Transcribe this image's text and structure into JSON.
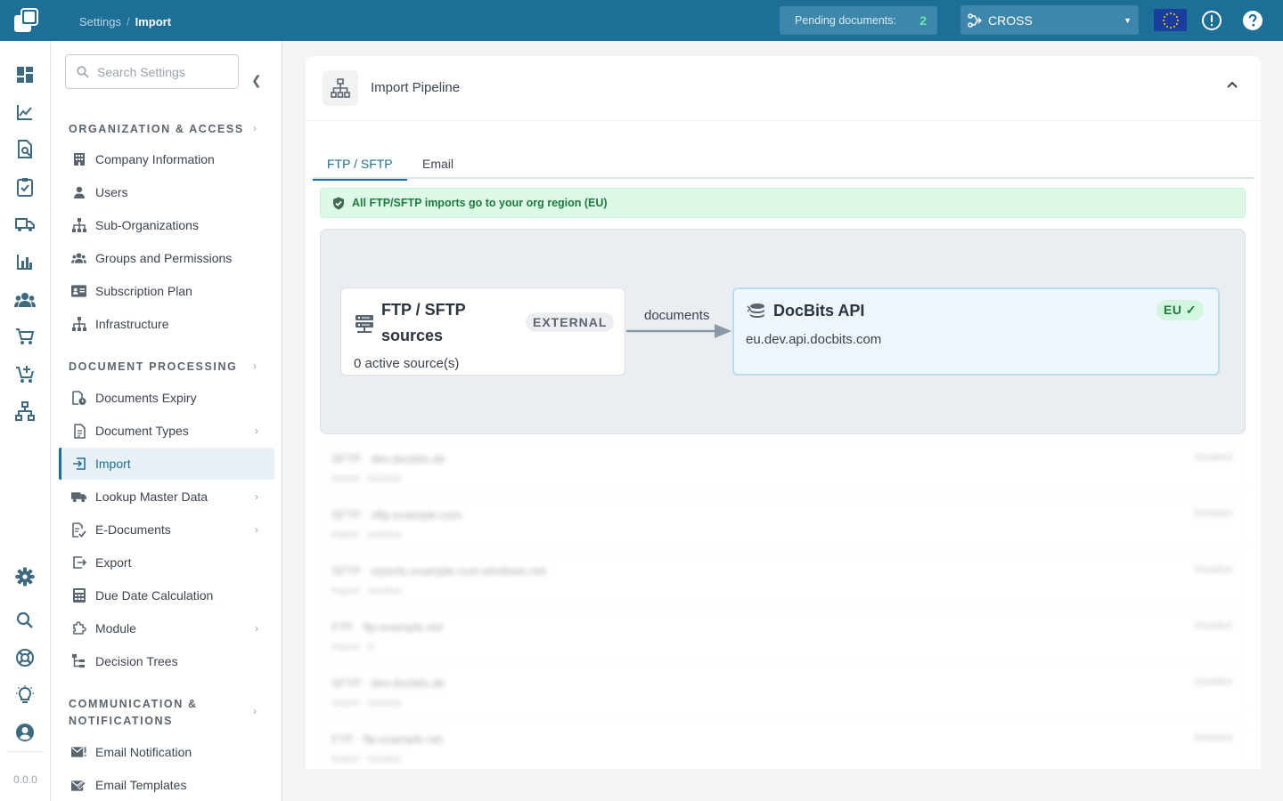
{
  "topbar": {
    "breadcrumb": [
      "Settings",
      "Import"
    ],
    "pending_label": "Pending documents:",
    "pending_count": "2",
    "org": "CROSS",
    "colors": {
      "bar": "#1e6f98",
      "pending_count": "#6ee7a0"
    }
  },
  "rail": {
    "icons": [
      "dashboard-icon",
      "chart-line-icon",
      "document-search-icon",
      "clipboard-check-icon",
      "truck-icon",
      "bar-chart-icon",
      "people-icon",
      "cart-icon",
      "cart-plus-icon",
      "network-icon",
      "settings-icon",
      "search-icon",
      "lifebuoy-icon",
      "lightbulb-icon",
      "account-icon"
    ],
    "version": "0.0.0"
  },
  "sidebar": {
    "search_placeholder": "Search Settings",
    "sections": [
      {
        "title": "ORGANIZATION & ACCESS",
        "items": [
          {
            "label": "Company Information"
          },
          {
            "label": "Users"
          },
          {
            "label": "Sub-Organizations"
          },
          {
            "label": "Groups and Permissions"
          },
          {
            "label": "Subscription Plan"
          },
          {
            "label": "Infrastructure"
          }
        ]
      },
      {
        "title": "DOCUMENT PROCESSING",
        "items": [
          {
            "label": "Documents Expiry"
          },
          {
            "label": "Document Types"
          },
          {
            "label": "Import"
          },
          {
            "label": "Lookup Master Data"
          },
          {
            "label": "E-Documents"
          },
          {
            "label": "Export"
          },
          {
            "label": "Due Date Calculation"
          },
          {
            "label": "Module"
          },
          {
            "label": "Decision Trees"
          }
        ]
      },
      {
        "title_line1": "COMMUNICATION &",
        "title_line2": "NOTIFICATIONS",
        "items": [
          {
            "label": "Email Notification"
          },
          {
            "label": "Email Templates"
          }
        ]
      }
    ]
  },
  "main": {
    "title": "Import Pipeline",
    "tabs": [
      "FTP / SFTP",
      "Email"
    ],
    "notice": "All FTP/SFTP imports go to your org region (EU)",
    "pipeline": {
      "source": {
        "name": "FTP / SFTP sources",
        "badge": "EXTERNAL",
        "meta": "0 active source(s)"
      },
      "edge_label": "documents",
      "destination": {
        "name": "DocBits API",
        "badge": "EU ✓",
        "meta": "eu.dev.api.docbits.com"
      }
    },
    "blurred_rows": [
      {
        "l1": "SFTP · dev.docbits.de",
        "l2": "Import · inactive",
        "r": "Disabled"
      },
      {
        "l1": "SFTP · sftp.example.com",
        "l2": "Import · inactive",
        "r": "Disabled"
      },
      {
        "l1": "SFTP · reports.example.com.windows.net",
        "l2": "Import · inactive",
        "r": "Disabled"
      },
      {
        "l1": "FTP · ftp.example.net",
        "l2": "Import · 0",
        "r": "Disabled"
      },
      {
        "l1": "SFTP · dev.docbits.de",
        "l2": "Import · inactive",
        "r": "Disabled"
      },
      {
        "l1": "FTP · ftp.example.net",
        "l2": "Import · inactive",
        "r": "Disabled"
      }
    ]
  }
}
